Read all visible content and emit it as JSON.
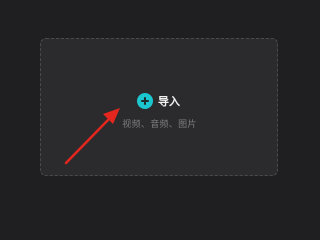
{
  "drop_zone": {
    "import_label": "导入",
    "hint": "视频、音频、图片",
    "icon": "plus-circle-icon"
  },
  "colors": {
    "background": "#1f1f21",
    "panel": "#2b2b2d",
    "accent": "#1cc6cf",
    "arrow": "#e3261e"
  }
}
